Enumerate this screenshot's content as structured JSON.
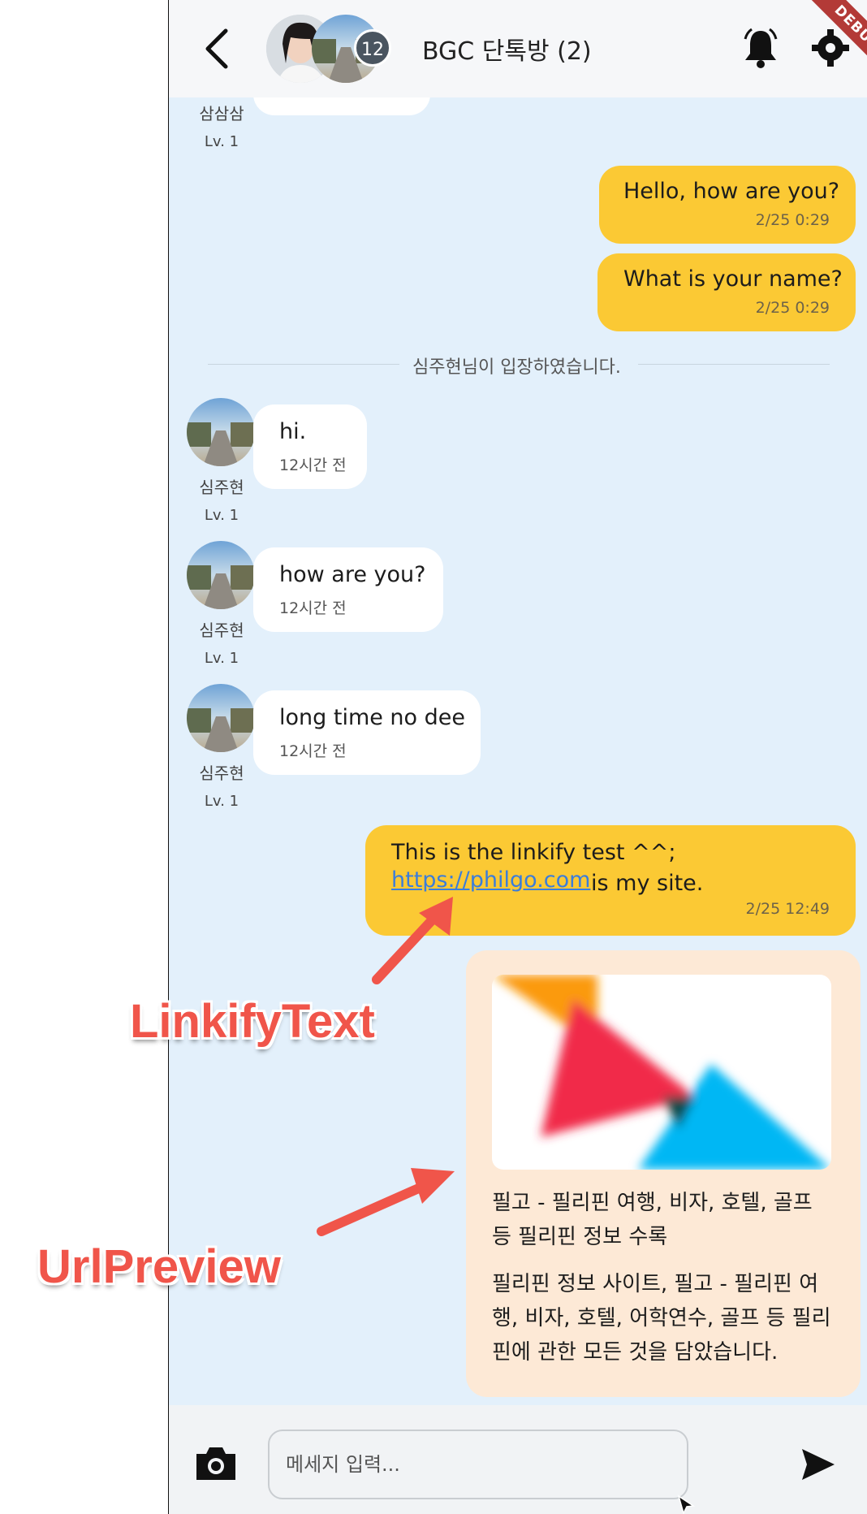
{
  "header": {
    "title": "BGC 단톡방 (2)",
    "member_count": "12",
    "debug_label": "DEBUG"
  },
  "messages": {
    "top_user": {
      "name": "삼삼삼",
      "level": "Lv. 1"
    },
    "mine1": {
      "text": "Hello, how are you?",
      "time": "2/25 0:29"
    },
    "mine2": {
      "text": "What is your name?",
      "time": "2/25 0:29"
    },
    "system": "심주현님이 입장하였습니다.",
    "their1": {
      "name": "심주현",
      "level": "Lv. 1",
      "text": "hi.",
      "time": "12시간 전"
    },
    "their2": {
      "name": "심주현",
      "level": "Lv. 1",
      "text": "how are you?",
      "time": "12시간 전"
    },
    "their3": {
      "name": "심주현",
      "level": "Lv. 1",
      "text": "long time no dee",
      "time": "12시간 전"
    },
    "linkify": {
      "line1": "This is the linkify test ^^;",
      "link": "https://philgo.com",
      "after_link": "is my site.",
      "time": "2/25 12:49"
    }
  },
  "preview": {
    "title": "필고 - 필리핀 여행, 비자, 호텔, 골프 등 필리핀 정보 수록",
    "description": "필리핀 정보 사이트, 필고 - 필리핀 여행, 비자, 호텔, 어학연수, 골프 등 필리핀에 관한 모든 것을 담았습니다."
  },
  "input": {
    "placeholder": "메세지 입력..."
  },
  "annotations": {
    "linkify_label": "LinkifyText",
    "preview_label": "UrlPreview"
  },
  "colors": {
    "mine_bubble": "#fbc934",
    "theirs_bubble": "#ffffff",
    "preview_bg": "#fde9d6",
    "chat_bg": "#e3f0fb",
    "link": "#3b7ddb",
    "annotation": "#f0554a"
  },
  "icons": [
    "back-icon",
    "bell-icon",
    "gear-icon",
    "camera-icon",
    "send-icon"
  ]
}
